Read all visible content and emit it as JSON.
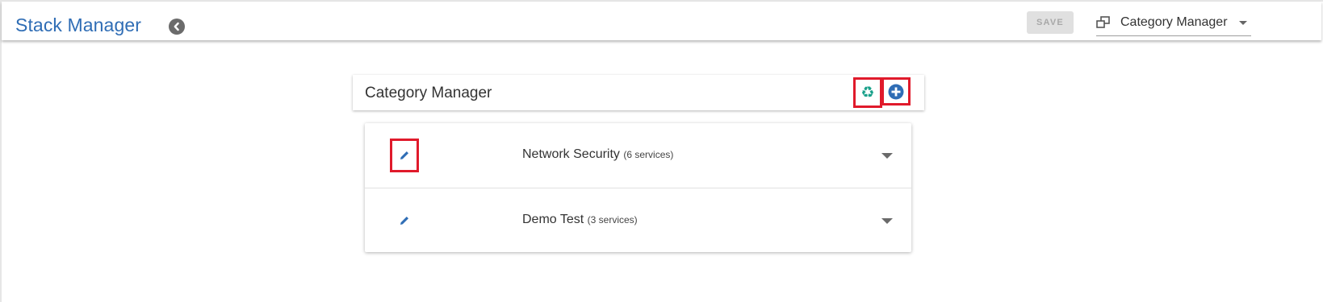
{
  "header": {
    "app_title": "Stack Manager",
    "back_icon": "chevron-left-circle-icon",
    "save_label": "SAVE",
    "view_selector": {
      "icon": "windows-icon",
      "selected": "Category Manager"
    }
  },
  "panel": {
    "title": "Category Manager",
    "actions": [
      {
        "name": "recycle",
        "icon": "recycle-icon",
        "color": "#1aa08a"
      },
      {
        "name": "add",
        "icon": "plus-circle-icon",
        "color": "#2f6db5"
      }
    ]
  },
  "categories": [
    {
      "name": "Network Security",
      "count_label": "(6 services)"
    },
    {
      "name": "Demo Test",
      "count_label": "(3 services)"
    }
  ],
  "colors": {
    "brand": "#2f6db5",
    "highlight": "#e01a2b",
    "recycle": "#1aa08a"
  }
}
